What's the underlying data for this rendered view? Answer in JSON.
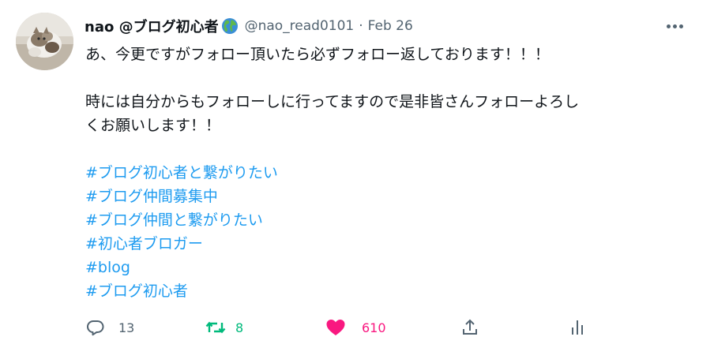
{
  "tweet": {
    "author_name": "nao @ブログ初心者",
    "author_emoji_icon": "globe-americas-icon",
    "handle": "@nao_read0101",
    "separator": "·",
    "date": "Feb 26",
    "more_icon": "ellipsis-icon",
    "body_lines": [
      "あ、今更ですがフォロー頂いたら必ずフォロー返しております！！！",
      "",
      "時には自分からもフォローしに行ってますので是非皆さんフォローよろし",
      "くお願いします！！"
    ],
    "hashtags": [
      "#ブログ初心者と繋がりたい",
      "#ブログ仲間募集中",
      "#ブログ仲間と繋がりたい",
      "#初心者ブロガー",
      "#blog",
      "#ブログ初心者"
    ]
  },
  "actions": {
    "reply": {
      "icon": "reply-bubble-icon",
      "count": "13"
    },
    "retweet": {
      "icon": "retweet-icon",
      "count": "8",
      "active": true
    },
    "like": {
      "icon": "heart-icon",
      "count": "610",
      "active": true
    },
    "share": {
      "icon": "share-icon"
    },
    "analytics": {
      "icon": "analytics-icon"
    }
  },
  "colors": {
    "text": "#0f1419",
    "muted": "#536471",
    "link": "#1d9bf0",
    "retweet_green": "#00ba7c",
    "like_pink": "#f91880"
  }
}
